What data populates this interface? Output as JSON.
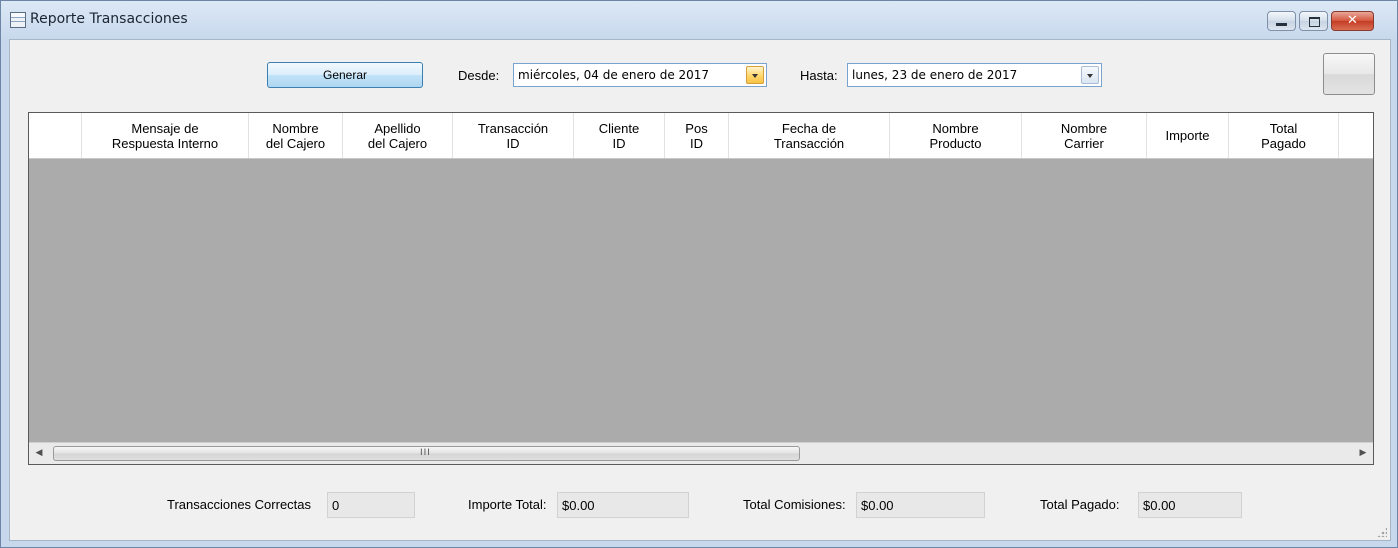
{
  "window": {
    "title": "Reporte Transacciones"
  },
  "toolbar": {
    "generar_label": "Generar",
    "desde_label": "Desde:",
    "desde_value": "miércoles, 04 de enero de 2017",
    "hasta_label": "Hasta:",
    "hasta_value": "lunes, 23 de enero de 2017"
  },
  "grid": {
    "columns": [
      "Mensaje de\nRespuesta Interno",
      "Nombre\ndel Cajero",
      "Apellido\ndel Cajero",
      "Transacción\nID",
      "Cliente\nID",
      "Pos\nID",
      "Fecha de\nTransacción",
      "Nombre\nProducto",
      "Nombre\nCarrier",
      "Importe",
      "Total\nPagado"
    ],
    "rows": [],
    "scroll_grip": "III"
  },
  "summary": {
    "correctas_label": "Transacciones Correctas",
    "correctas_value": "0",
    "importe_label": "Importe Total:",
    "importe_value": "$0.00",
    "comisiones_label": "Total Comisiones:",
    "comisiones_value": "$0.00",
    "pagado_label": "Total Pagado:",
    "pagado_value": "$0.00"
  },
  "icons": {
    "app": "report-icon",
    "minimize": "minimize-icon",
    "maximize": "maximize-icon",
    "close": "close-icon",
    "dropdown": "chevron-down-icon",
    "scroll_left": "scroll-left-icon",
    "scroll_right": "scroll-right-icon"
  },
  "colors": {
    "grid_background": "#ababab",
    "header_background": "#ffffff",
    "close_button": "#c43c25",
    "window_frame": "#c7d8ec"
  }
}
